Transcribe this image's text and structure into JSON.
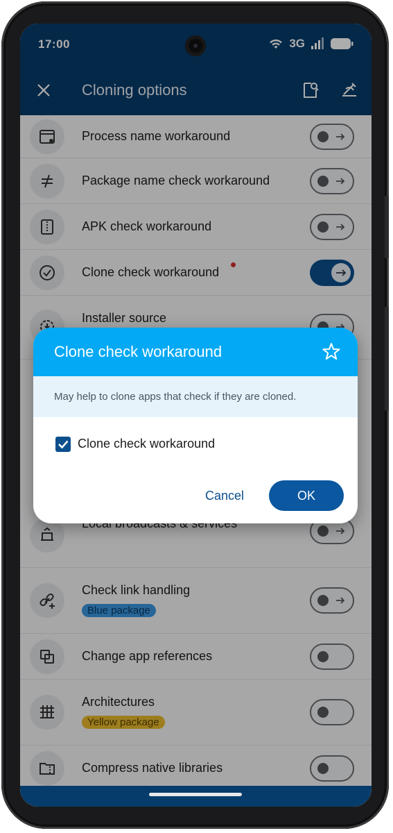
{
  "status_bar": {
    "time": "17:00",
    "network": "3G"
  },
  "app_bar": {
    "title": "Cloning options"
  },
  "list_items": [
    {
      "label": "Process name workaround",
      "icon": "window-gear-icon",
      "toggle": "off"
    },
    {
      "label": "Package name check workaround",
      "icon": "not-equal-icon",
      "toggle": "off"
    },
    {
      "label": "APK check workaround",
      "icon": "zip-file-icon",
      "toggle": "off"
    },
    {
      "label": "Clone check workaround",
      "icon": "check-circle-icon",
      "toggle": "on",
      "new_dot": true
    },
    {
      "label": "Installer source",
      "icon": "installer-icon",
      "toggle": "off"
    },
    {
      "label": "Local broadcasts & services",
      "icon": "broadcast-icon",
      "toggle": "off"
    },
    {
      "label": "Check link handling",
      "icon": "link-add-icon",
      "badge": "Blue package",
      "toggle": "off"
    },
    {
      "label": "Change app references",
      "icon": "swap-icon",
      "toggle": "off"
    },
    {
      "label": "Architectures",
      "icon": "chip-icon",
      "badge": "Yellow package",
      "toggle": "off"
    },
    {
      "label": "Compress native libraries",
      "icon": "folder-zip-icon",
      "toggle": "off"
    }
  ],
  "dialog": {
    "title": "Clone check workaround",
    "message": "May help to clone apps that check if they are cloned.",
    "checkbox_label": "Clone check workaround",
    "checkbox_checked": true,
    "cancel_label": "Cancel",
    "ok_label": "OK"
  },
  "colors": {
    "app_bar": "#063c6b",
    "dialog_header": "#03a9f4",
    "primary": "#0b57a0"
  }
}
